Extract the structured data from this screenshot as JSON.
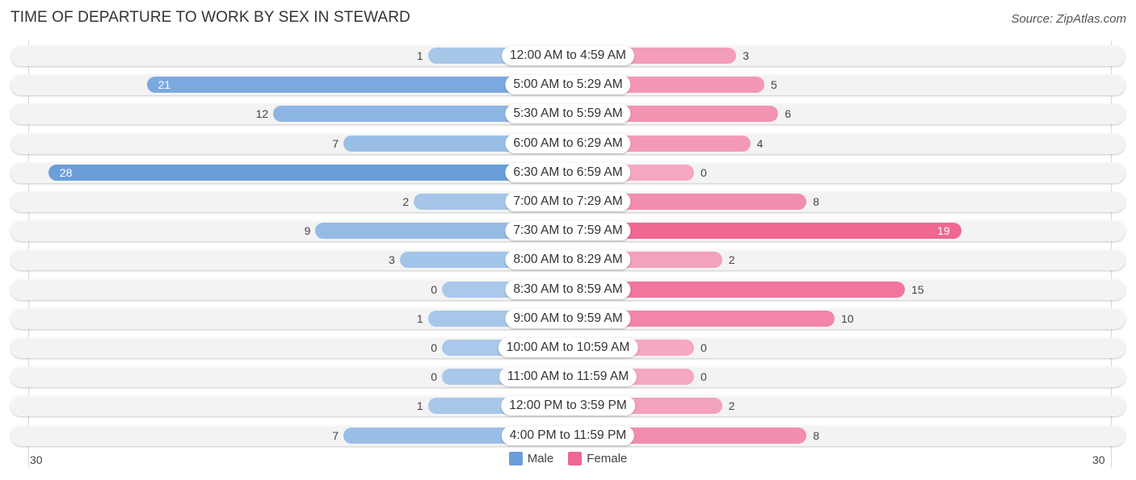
{
  "header": {
    "title": "TIME OF DEPARTURE TO WORK BY SEX IN STEWARD",
    "source": "Source: ZipAtlas.com"
  },
  "colors": {
    "male_strong": "#6a9fdb",
    "male_light": "#a9c8ea",
    "female_strong": "#f06792",
    "female_light": "#f5a8c0"
  },
  "legend": [
    {
      "label": "Male",
      "color": "#6a9fdb"
    },
    {
      "label": "Female",
      "color": "#f06792"
    }
  ],
  "axis": {
    "left_label": "30",
    "right_label": "30"
  },
  "chart_data": {
    "type": "bar",
    "orientation": "horizontal-diverging",
    "title": "TIME OF DEPARTURE TO WORK BY SEX IN STEWARD",
    "xlabel": "",
    "ylabel": "",
    "xlim": [
      -30,
      30
    ],
    "legend_position": "bottom",
    "categories": [
      "12:00 AM to 4:59 AM",
      "5:00 AM to 5:29 AM",
      "5:30 AM to 5:59 AM",
      "6:00 AM to 6:29 AM",
      "6:30 AM to 6:59 AM",
      "7:00 AM to 7:29 AM",
      "7:30 AM to 7:59 AM",
      "8:00 AM to 8:29 AM",
      "8:30 AM to 8:59 AM",
      "9:00 AM to 9:59 AM",
      "10:00 AM to 10:59 AM",
      "11:00 AM to 11:59 AM",
      "12:00 PM to 3:59 PM",
      "4:00 PM to 11:59 PM"
    ],
    "series": [
      {
        "name": "Male",
        "values": [
          1,
          21,
          12,
          7,
          28,
          2,
          9,
          3,
          0,
          1,
          0,
          0,
          1,
          7
        ]
      },
      {
        "name": "Female",
        "values": [
          3,
          5,
          6,
          4,
          0,
          8,
          19,
          2,
          15,
          10,
          0,
          0,
          2,
          8
        ]
      }
    ],
    "tick_labels": [
      "30",
      "30"
    ]
  }
}
